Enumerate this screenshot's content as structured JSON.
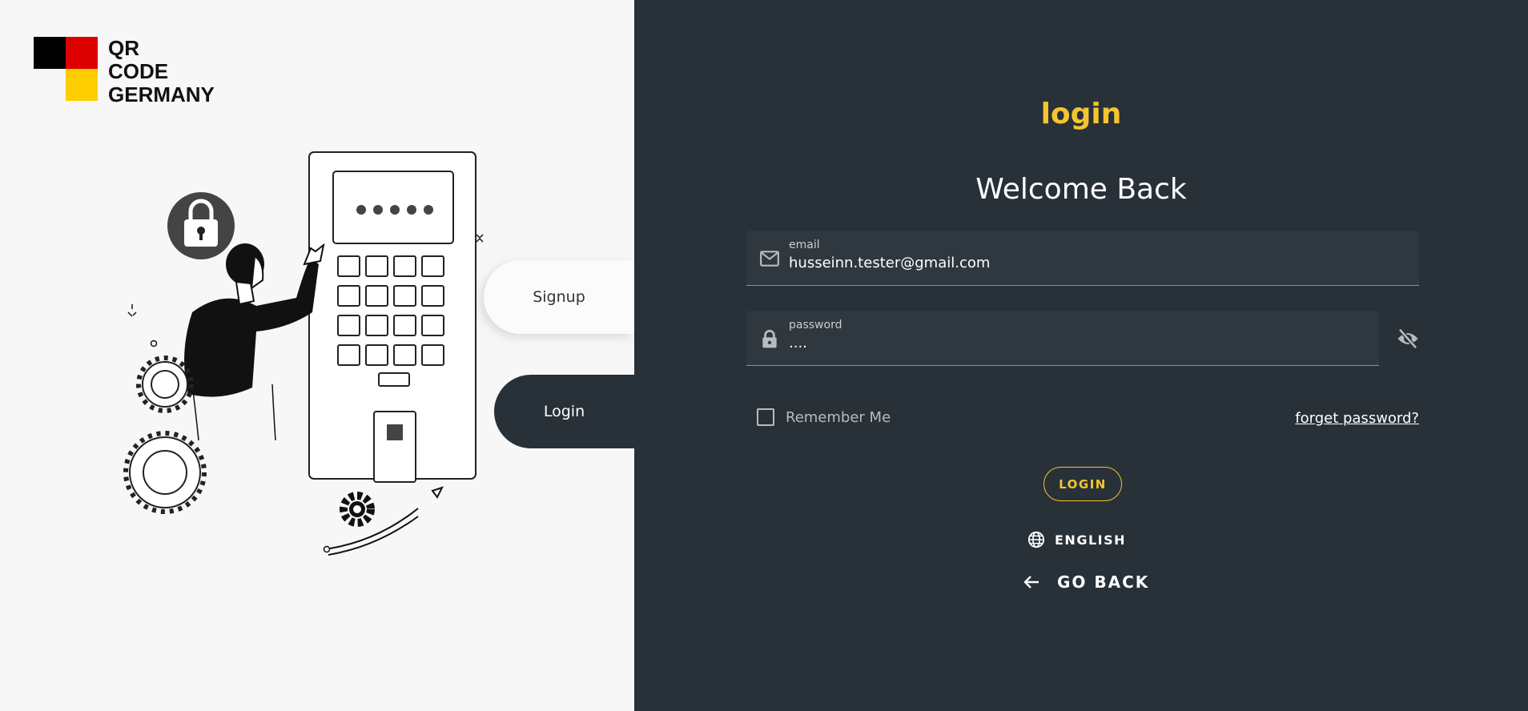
{
  "brand": {
    "logo_text": [
      "QR",
      "CODE",
      "GERMANY"
    ],
    "flag_colors": {
      "black": "#000000",
      "red": "#dd0000",
      "gold": "#ffce00"
    }
  },
  "left_panel": {
    "illustration": "person-entering-pin-on-keypad",
    "signup_label": "Signup",
    "login_label": "Login"
  },
  "form": {
    "heading": "login",
    "welcome": "Welcome Back",
    "email": {
      "label": "email",
      "value": "husseinn.tester@gmail.com",
      "icon": "mail-icon"
    },
    "password": {
      "label": "password",
      "value": "....",
      "icon": "lock-icon",
      "toggle_icon": "eye-off-icon"
    },
    "remember_label": "Remember Me",
    "remember_checked": false,
    "forgot_label": "forget password?",
    "submit_label": "LOGIN",
    "language_label": "ENGLISH",
    "go_back_label": "GO BACK"
  },
  "colors": {
    "panel_dark": "#283038",
    "field_bg": "#2f383f",
    "accent_yellow": "#f3c52f",
    "left_bg": "#f7f7f7"
  }
}
